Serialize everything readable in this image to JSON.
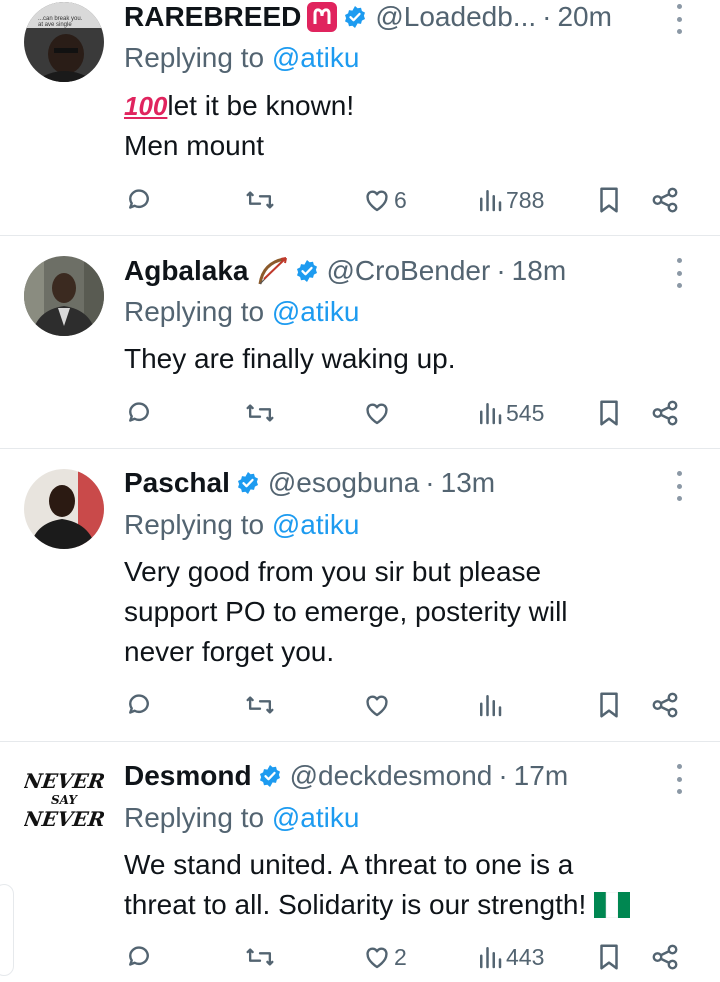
{
  "tweets": [
    {
      "name": "RAREBREED",
      "name_emoji": "♈",
      "handle": "@Loadedb...",
      "dot": "·",
      "time": "20m",
      "replying_prefix": "Replying to",
      "replying_to": "@atiku",
      "body_lines": [
        "💯let it be known!",
        "Men mount"
      ],
      "avatar_caption": "...can break you.\nat ave single",
      "stats": {
        "replies": "",
        "retweets": "",
        "likes": "6",
        "views": "788"
      }
    },
    {
      "name": "Agbalaka",
      "name_emoji": "🏹",
      "handle": "@CroBender",
      "dot": "·",
      "time": "18m",
      "replying_prefix": "Replying to",
      "replying_to": "@atiku",
      "body_lines": [
        "They are finally waking up."
      ],
      "stats": {
        "replies": "",
        "retweets": "",
        "likes": "",
        "views": "545"
      }
    },
    {
      "name": "Paschal",
      "handle": "@esogbuna",
      "dot": "·",
      "time": "13m",
      "replying_prefix": "Replying to",
      "replying_to": "@atiku",
      "body_lines": [
        "Very good from you sir but please",
        "support PO to emerge, posterity will",
        "never forget you."
      ],
      "stats": {
        "replies": "",
        "retweets": "",
        "likes": "",
        "views": ""
      }
    },
    {
      "name": "Desmond",
      "handle": "@deckdesmond",
      "dot": "·",
      "time": "17m",
      "replying_prefix": "Replying to",
      "replying_to": "@atiku",
      "body_lines": [
        "We stand united. A threat to one is a",
        "threat to all. Solidarity is our strength!"
      ],
      "avatar_text": [
        "NEVER",
        "SAY",
        "NEVER"
      ],
      "stats": {
        "replies": "",
        "retweets": "",
        "likes": "2",
        "views": "443"
      }
    }
  ],
  "colors": {
    "accent": "#1d9bf0",
    "secondary_text": "#536471",
    "aries_red": "#e0245e",
    "flag_green": "#008751"
  },
  "icons": [
    "reply-icon",
    "retweet-icon",
    "like-icon",
    "views-icon",
    "bookmark-icon",
    "share-icon",
    "verified-badge-icon",
    "more-icon"
  ]
}
